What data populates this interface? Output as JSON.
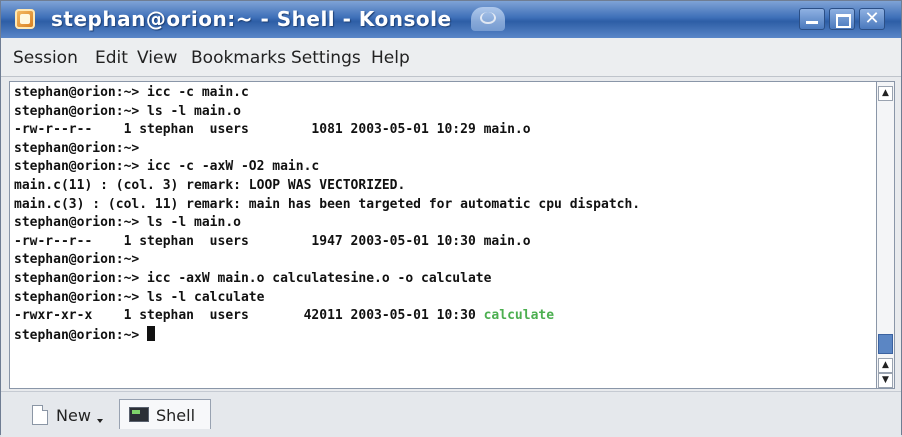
{
  "window": {
    "title": "stephan@orion:~ - Shell - Konsole"
  },
  "menu": [
    "Session",
    "Edit",
    "View",
    "Bookmarks",
    "Settings",
    "Help"
  ],
  "terminal": {
    "lines": [
      "stephan@orion:~> icc -c main.c",
      "stephan@orion:~> ls -l main.o",
      "-rw-r--r--    1 stephan  users        1081 2003-05-01 10:29 main.o",
      "stephan@orion:~>",
      "stephan@orion:~> icc -c -axW -O2 main.c",
      "main.c(11) : (col. 3) remark: LOOP WAS VECTORIZED.",
      "main.c(3) : (col. 11) remark: main has been targeted for automatic cpu dispatch.",
      "stephan@orion:~> ls -l main.o",
      "-rw-r--r--    1 stephan  users        1947 2003-05-01 10:30 main.o",
      "stephan@orion:~>",
      "stephan@orion:~> icc -axW main.o calculatesine.o -o calculate",
      "stephan@orion:~> ls -l calculate"
    ],
    "listing_prefix": "-rwxr-xr-x    1 stephan  users       42011 2003-05-01 10:30 ",
    "listing_file": "calculate",
    "prompt": "stephan@orion:~> ",
    "highlight_color": "#4caf50"
  },
  "tabs": {
    "new_label": "New",
    "shell_label": "Shell"
  },
  "icons": {
    "app": "konsole-icon",
    "minimize": "minimize-icon",
    "maximize": "maximize-icon",
    "close": "close-icon",
    "new_tab": "new-document-icon",
    "shell_tab": "terminal-icon"
  }
}
